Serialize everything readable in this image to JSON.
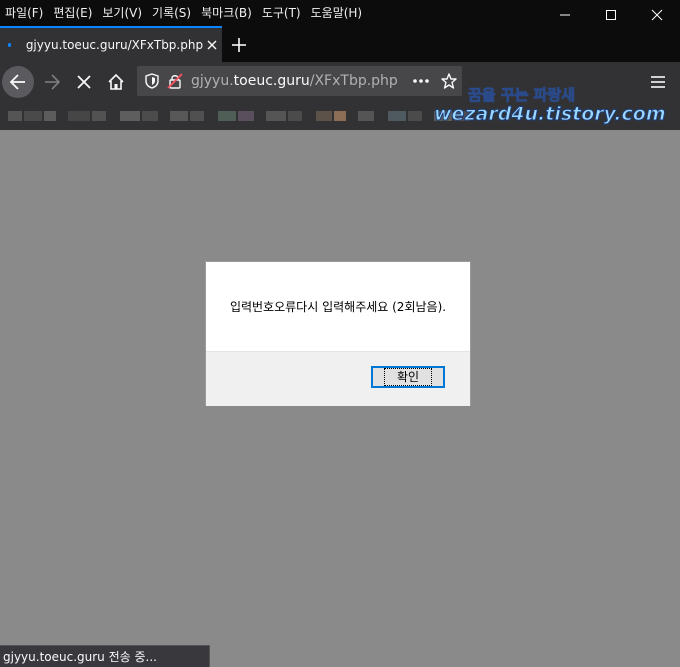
{
  "menu": {
    "items": [
      "파일(F)",
      "편집(E)",
      "보기(V)",
      "기록(S)",
      "북마크(B)",
      "도구(T)",
      "도움말(H)"
    ]
  },
  "tab": {
    "title": "gjyyu.toeuc.guru/XFxTbp.php"
  },
  "urlbar": {
    "prefix": "gjyyu.",
    "host": "toeuc.guru",
    "path": "/XFxTbp.php"
  },
  "watermark": {
    "line1": "꿈을 꾸는 파랑새",
    "line2": "wezard4u.tistory.com"
  },
  "dialog": {
    "message": "입력번호오류다시 입력해주세요 (2회남음).",
    "ok_label": "확인"
  },
  "status": {
    "text": "gjyyu.toeuc.guru 전송 중..."
  },
  "colors": {
    "accent": "#0a84ff",
    "page_bg": "#8a8a8a",
    "chrome_bg": "#0c0c0d",
    "toolbar_bg": "#323234"
  }
}
